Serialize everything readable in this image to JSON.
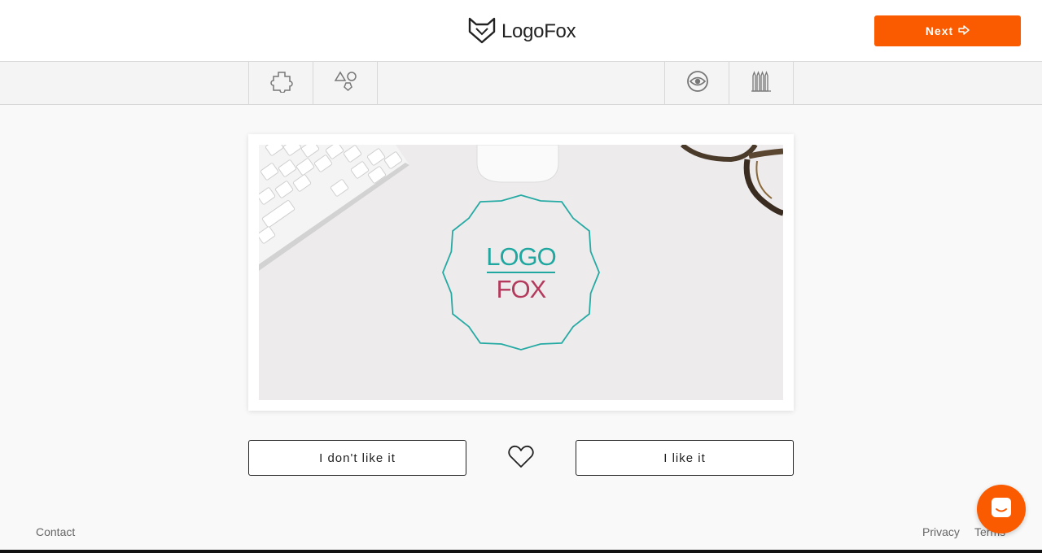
{
  "header": {
    "brand_name": "LogoFox",
    "next_label": "Next"
  },
  "toolbar": {
    "tools": [
      {
        "icon": "puzzle-icon"
      },
      {
        "icon": "shapes-icon"
      },
      {
        "icon": "eye-icon"
      },
      {
        "icon": "pencils-icon"
      }
    ]
  },
  "preview": {
    "logo_line1": "LOGO",
    "logo_line2": "FOX",
    "colors": {
      "teal": "#1fa7a0",
      "crimson": "#b33a5c"
    }
  },
  "actions": {
    "dislike_label": "I don't like it",
    "like_label": "I like it"
  },
  "footer": {
    "contact": "Contact",
    "privacy": "Privacy",
    "terms": "Terms"
  },
  "colors": {
    "accent": "#fa5a00"
  }
}
